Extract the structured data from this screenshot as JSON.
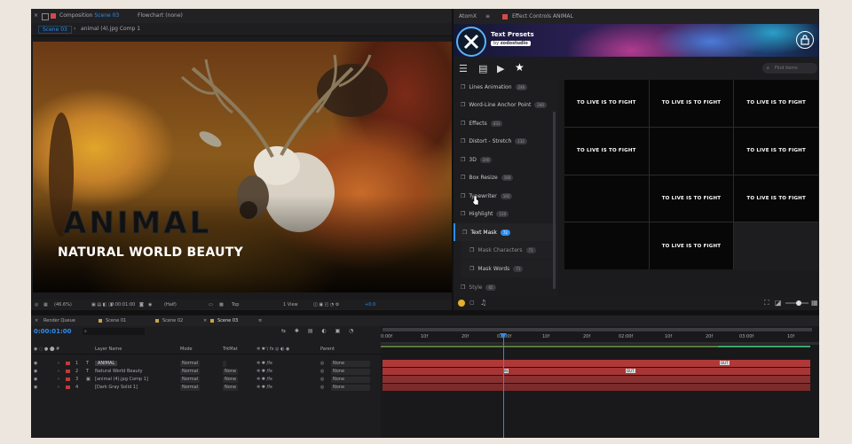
{
  "comp_panel": {
    "tab_composition": "Composition",
    "tab_composition_name": "Scene 03",
    "tab_flowchart": "Flowchart",
    "tab_flowchart_value": "(none)",
    "crumb_scene": "Scene 03",
    "crumb_layer": "animal (4).jpg Comp 1",
    "overlay_title": "ANIMAL",
    "overlay_subtitle": "NATURAL WORLD BEAUTY",
    "footer": {
      "zoom": "(46.6%)",
      "timecode": "0:00:01:00",
      "resolution": "(Half)",
      "view_layout": "Top",
      "views": "1 View",
      "exposure": "+0.0"
    }
  },
  "right_panel": {
    "tab_atomx": "AtomX",
    "tab_effect_controls": "Effect Controls ANIMAL",
    "banner_title": "Text Presets",
    "banner_by": "by",
    "banner_author": "zodostudio",
    "search_placeholder": "Find items",
    "categories": [
      {
        "label": "Lines Animation",
        "count": "246"
      },
      {
        "label": "Word-Line Anchor Point",
        "count": "240"
      },
      {
        "label": "Effects",
        "count": "431"
      },
      {
        "label": "Distort - Stretch",
        "count": "132"
      },
      {
        "label": "3D",
        "count": "240"
      },
      {
        "label": "Box Resize",
        "count": "160"
      },
      {
        "label": "Typewriter",
        "count": "192"
      },
      {
        "label": "Highlight",
        "count": "120"
      },
      {
        "label": "Text Mask",
        "count": "72"
      },
      {
        "label": "Mask Characters",
        "count": "71"
      },
      {
        "label": "Mask Words",
        "count": "71"
      },
      {
        "label": "Style",
        "count": "65"
      }
    ],
    "preset_cells": [
      "TO LIVE IS TO FIGHT",
      "TO LIVE IS TO FIGHT",
      "TO LIVE IS TO FIGHT",
      "TO LIVE IS TO FIGHT",
      "",
      "TO LIVE IS TO FIGHT",
      "",
      "TO LIVE IS TO FIGHT",
      "TO LIVE IS TO FIGHT",
      "",
      "TO LIVE IS TO FIGHT",
      ""
    ]
  },
  "timeline": {
    "tabs": [
      "Render Queue",
      "Scene 01",
      "Scene 02",
      "Scene 03"
    ],
    "timecode": "0:00:01:00",
    "search_placeholder": "",
    "columns": {
      "name": "Layer Name",
      "mode": "Mode",
      "trkmat": "TrkMat",
      "parent": "Parent"
    },
    "layers": [
      {
        "num": "1",
        "type": "T",
        "name": "ANIMAL",
        "mode": "Normal",
        "trkmat": "",
        "parent": "None",
        "color": "#c23a3a"
      },
      {
        "num": "2",
        "type": "T",
        "name": "Natural World Beauty",
        "mode": "Normal",
        "trkmat": "None",
        "parent": "None",
        "color": "#c23a3a"
      },
      {
        "num": "3",
        "type": "",
        "name": "[animal (4).jpg Comp 1]",
        "mode": "Normal",
        "trkmat": "None",
        "parent": "None",
        "color": "#c23a3a"
      },
      {
        "num": "4",
        "type": "",
        "name": "[Dark Gray Solid 1]",
        "mode": "Normal",
        "trkmat": "None",
        "parent": "None",
        "color": "#c23a3a"
      }
    ],
    "ruler": [
      "0:00f",
      "10f",
      "20f",
      "01:00f",
      "10f",
      "20f",
      "02:00f",
      "10f",
      "20f",
      "03:00f",
      "10f"
    ],
    "markers": {
      "in": "IN",
      "out": "OUT",
      "out2": "OUT"
    }
  },
  "colors": {
    "accent": "#2d8ceb",
    "layer_bar": "#b83a3a",
    "panel_bg": "#1b1b1d"
  }
}
